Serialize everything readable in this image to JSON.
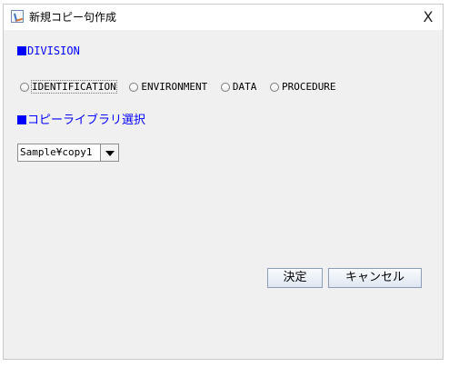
{
  "window": {
    "title": "新規コピー句作成",
    "close_symbol": "X"
  },
  "division": {
    "label": "DIVISION",
    "options": [
      {
        "label": "IDENTIFICATION",
        "selected": false,
        "focused": true
      },
      {
        "label": "ENVIRONMENT",
        "selected": false,
        "focused": false
      },
      {
        "label": "DATA",
        "selected": false,
        "focused": false
      },
      {
        "label": "PROCEDURE",
        "selected": false,
        "focused": false
      }
    ]
  },
  "library": {
    "label": "コピーライブラリ選択",
    "selected_value": "Sample¥copy1"
  },
  "buttons": {
    "ok": "決定",
    "cancel": "キャンセル"
  },
  "colors": {
    "section_label": "#0000ff",
    "panel_background": "#f0f0f0"
  },
  "icons": {
    "app": "java-coffee-icon",
    "close": "close-icon",
    "section_marker": "square-icon",
    "dropdown": "chevron-down-icon"
  }
}
